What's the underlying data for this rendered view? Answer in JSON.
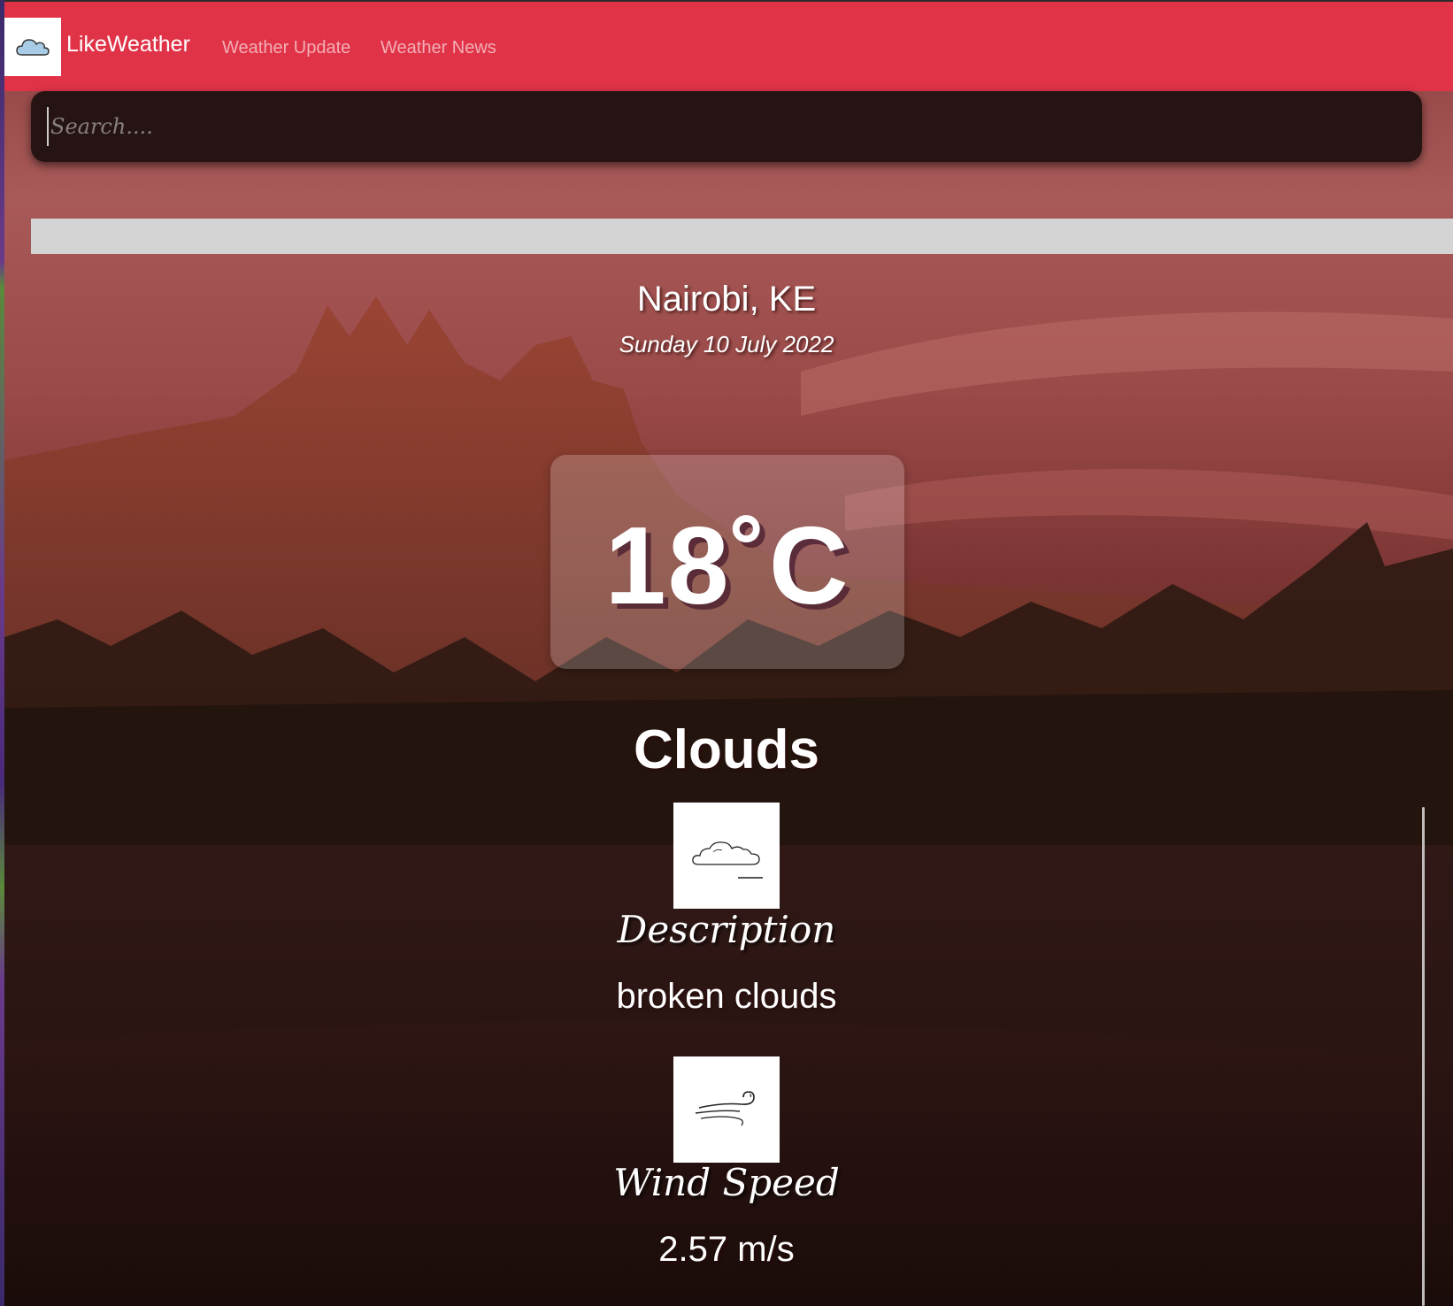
{
  "navbar": {
    "brand": "LikeWeather",
    "links": [
      "Weather Update",
      "Weather News"
    ]
  },
  "search": {
    "placeholder": "Search...."
  },
  "weather": {
    "location": "Nairobi, KE",
    "date": "Sunday 10 July 2022",
    "temperature": "18˚C",
    "main": "Clouds",
    "description_label": "Description",
    "description": "broken clouds",
    "wind_label": "Wind Speed",
    "wind_speed": "2.57 m/s"
  },
  "colors": {
    "navbar": "#e03348",
    "search_bg": "#261414",
    "gray_bar": "#d4d4d4"
  },
  "icons": [
    "cloud-logo-icon",
    "cloud-icon",
    "wind-icon"
  ]
}
